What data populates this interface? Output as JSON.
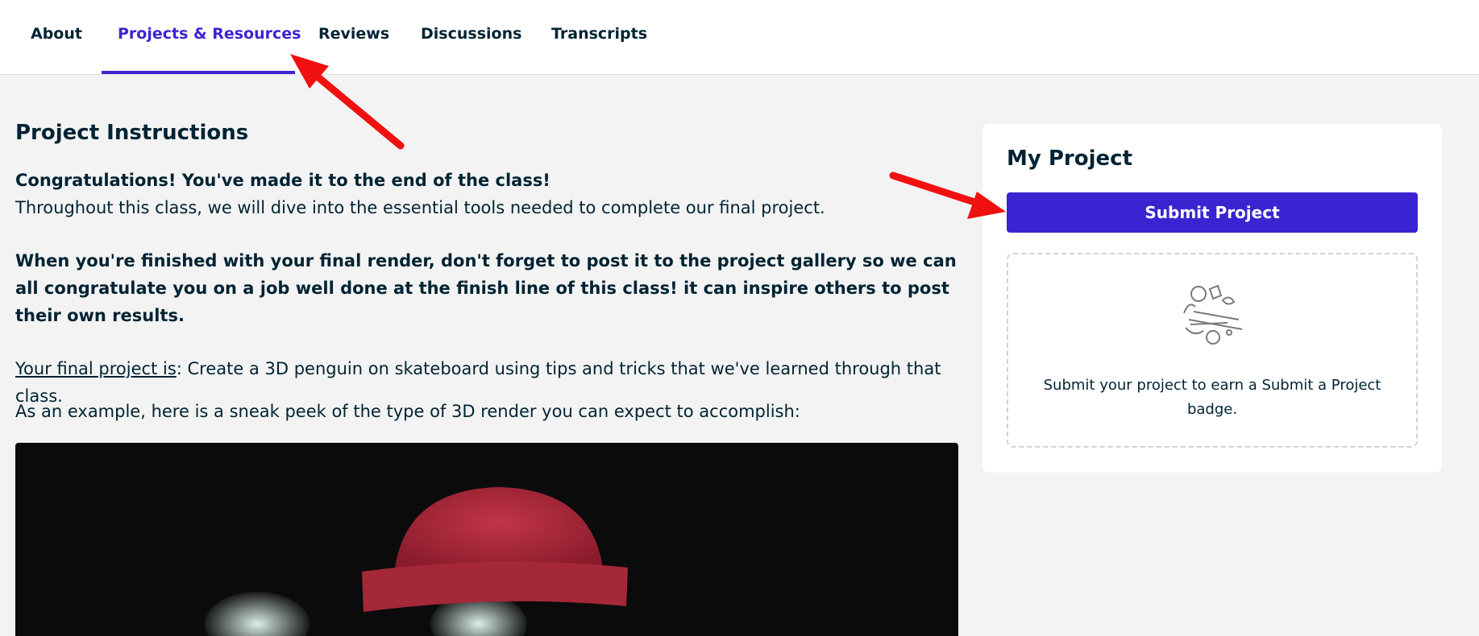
{
  "tabs": [
    {
      "label": "About"
    },
    {
      "label": "Projects & Resources"
    },
    {
      "label": "Reviews"
    },
    {
      "label": "Discussions"
    },
    {
      "label": "Transcripts"
    }
  ],
  "active_tab": "Projects & Resources",
  "main": {
    "title": "Project Instructions",
    "congrats": "Congratulations! You've made it to the end of the class!",
    "intro": "Throughout this class, we will dive into the essential tools needed to complete our final project.",
    "reminder": "When you're finished with your final render, don't forget to post it to the project gallery so we can all congratulate you on a job well done at the finish line of this class! it can inspire others to post their own results.",
    "final_label": "Your final project is",
    "final_text": ": Create a 3D penguin on skateboard using tips and tricks that we've learned through that class.",
    "example": "As an example, here is a sneak peek of the type of 3D render you can expect to accomplish:"
  },
  "sidebar": {
    "title": "My Project",
    "submit_label": "Submit Project",
    "empty_message": "Submit your project to earn a Submit a Project badge."
  },
  "colors": {
    "accent": "#3a24d1",
    "text": "#002333",
    "page_bg": "#f3f3f3",
    "annotation_arrow": "#f01010",
    "render_bg": "#0b0b0b",
    "hat": "#b3283c"
  },
  "icons": {
    "dropzone": "shapes-illustration-icon",
    "annotation": "red-arrow"
  }
}
